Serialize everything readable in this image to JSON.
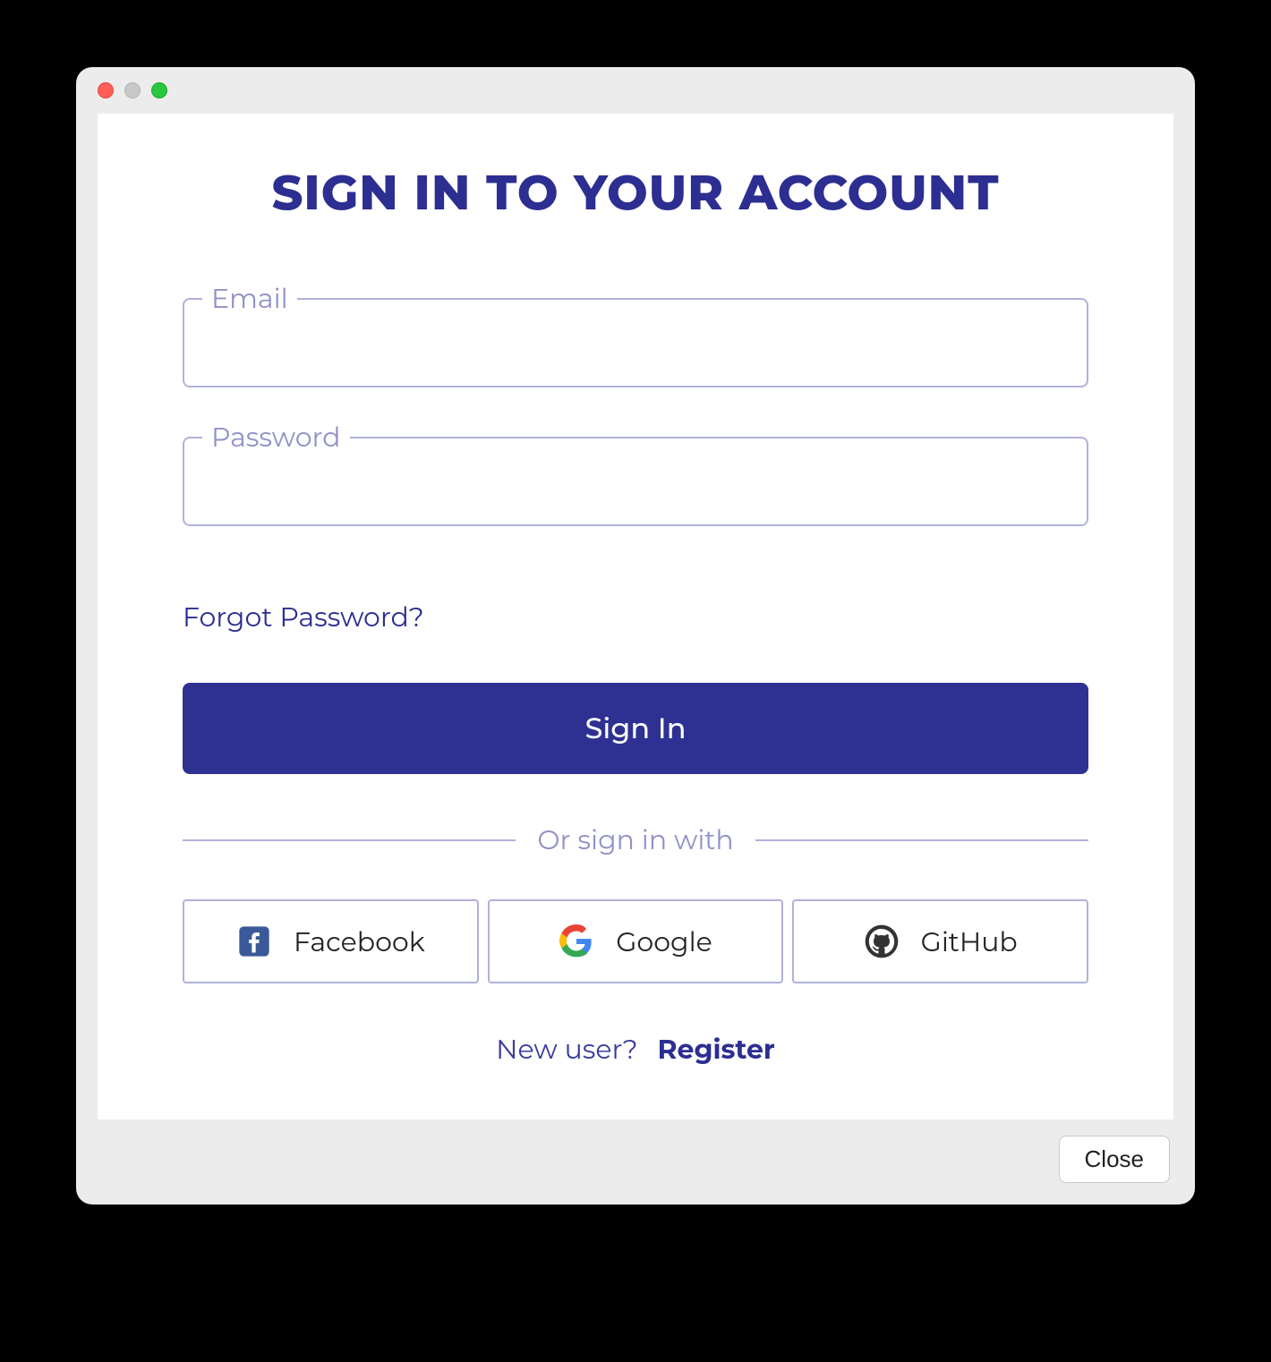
{
  "window": {
    "close_button": "Close"
  },
  "signin": {
    "title": "Sign In To Your Account",
    "email_label": "Email",
    "email_value": "",
    "password_label": "Password",
    "password_value": "",
    "forgot_link": "Forgot Password?",
    "submit_label": "Sign In",
    "divider_text": "Or sign in with",
    "social": [
      {
        "label": "Facebook",
        "icon": "facebook-icon"
      },
      {
        "label": "Google",
        "icon": "google-icon"
      },
      {
        "label": "GitHub",
        "icon": "github-icon"
      }
    ],
    "register_prompt": "New user?",
    "register_link": "Register"
  },
  "colors": {
    "primary": "#2e3192",
    "border": "#b1b1dc",
    "muted": "#9191c7"
  }
}
